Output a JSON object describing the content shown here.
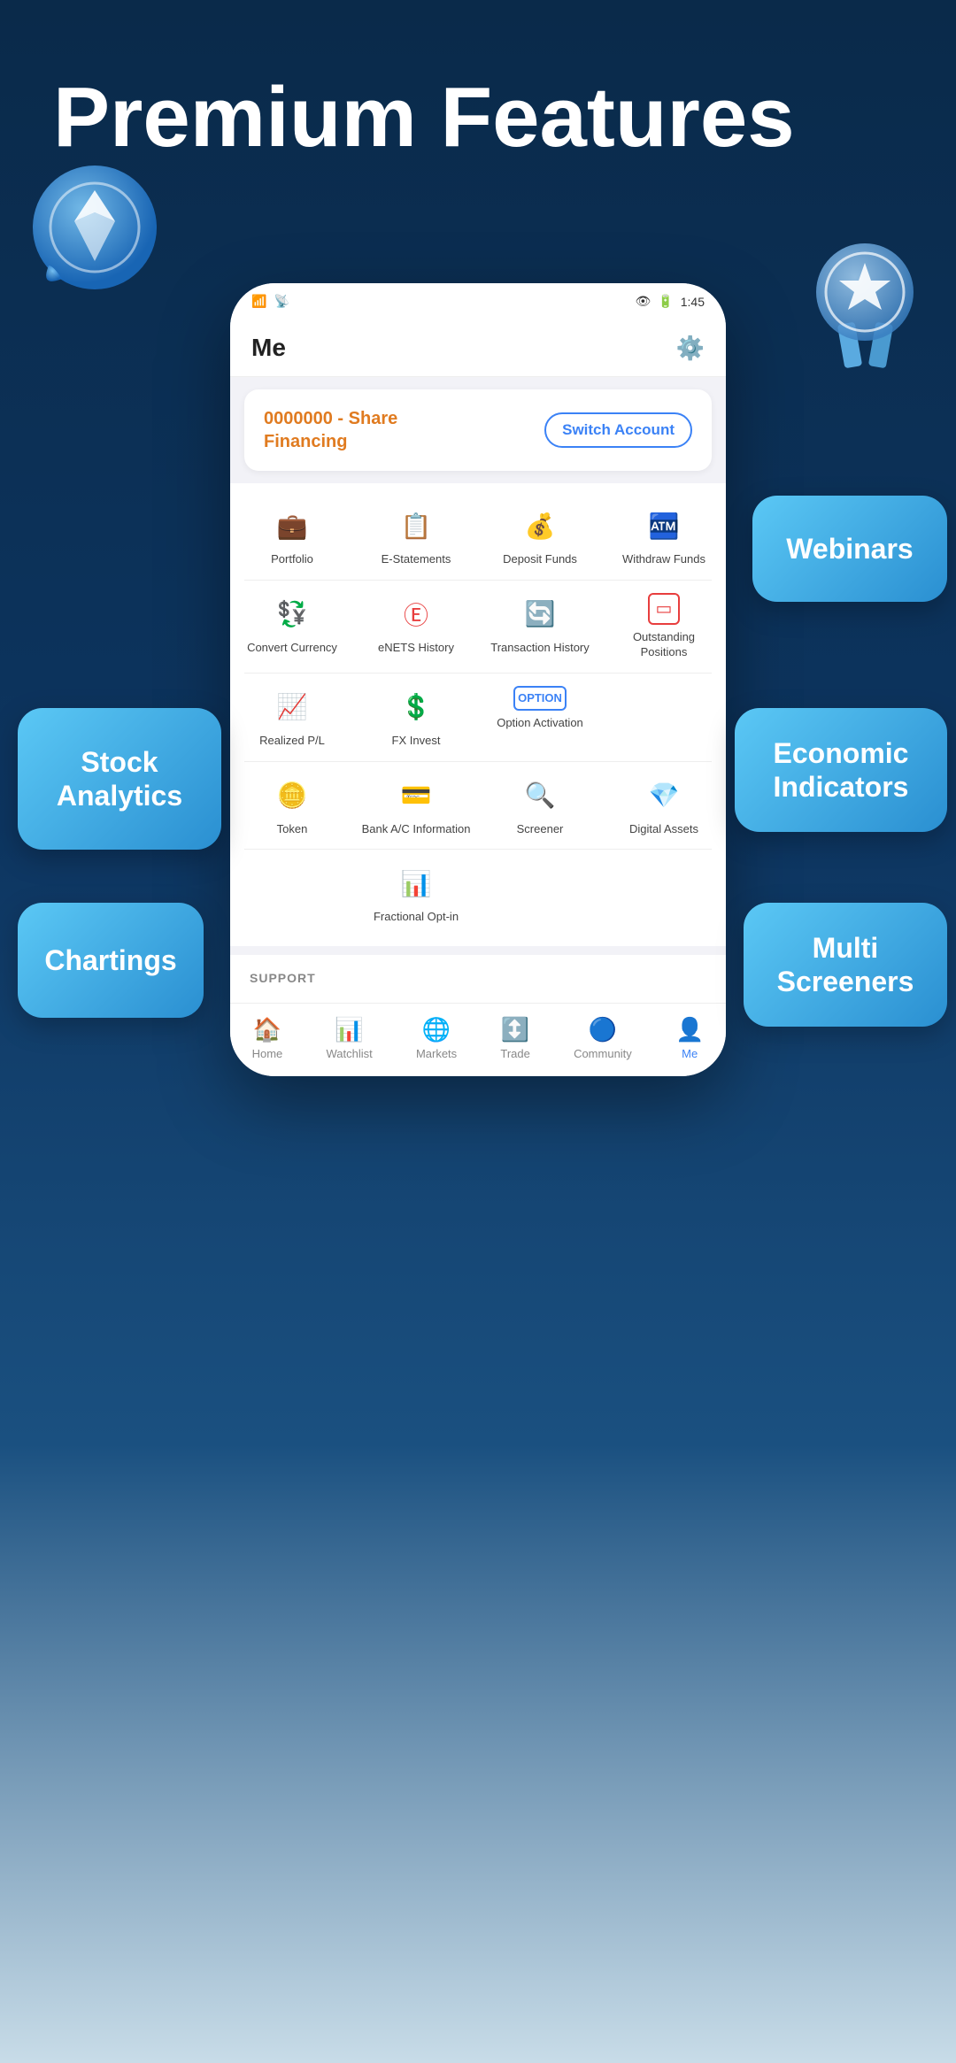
{
  "header": {
    "title": "Premium Features"
  },
  "status_bar": {
    "left": "4G signal wifi",
    "time": "1:45",
    "battery": "🔋"
  },
  "app": {
    "title": "Me",
    "settings_icon": "⚙️",
    "account_text": "0000000 - Share\nFinancing",
    "switch_button": "Switch Account"
  },
  "menu_rows": [
    [
      {
        "icon": "💼",
        "label": "Portfolio",
        "color": "#f5a623"
      },
      {
        "icon": "📋",
        "label": "E-Statements",
        "color": "#7b5ea7"
      },
      {
        "icon": "💰",
        "label": "Deposit Funds",
        "color": "#2dc58c"
      },
      {
        "icon": "🏧",
        "label": "Withdraw Funds",
        "color": "#3b82f6"
      }
    ],
    [
      {
        "icon": "💱",
        "label": "Convert Currency",
        "color": "#e07b20"
      },
      {
        "icon": "©️",
        "label": "eNETS History",
        "color": "#e83e3e"
      },
      {
        "icon": "🔄",
        "label": "Transaction History",
        "color": "#2dc58c"
      },
      {
        "icon": "⬜",
        "label": "Outstanding Positions",
        "color": "#e83e3e"
      }
    ],
    [
      {
        "icon": "📈",
        "label": "Realized P/L",
        "color": "#3b82f6"
      },
      {
        "icon": "💲",
        "label": "FX Invest",
        "color": "#e07b20"
      },
      {
        "icon": "🔲",
        "label": "Option Activation",
        "color": "#3b82f6"
      },
      {
        "icon": "",
        "label": "",
        "color": "transparent"
      }
    ],
    [
      {
        "icon": "🪙",
        "label": "Token",
        "color": "#e07b20"
      },
      {
        "icon": "💳",
        "label": "Bank A/C Information",
        "color": "#f5a623"
      },
      {
        "icon": "🔍",
        "label": "Screener",
        "color": "#7b5ea7"
      },
      {
        "icon": "💎",
        "label": "Digital Assets",
        "color": "#2dc58c"
      }
    ],
    [
      {
        "icon": "",
        "label": "",
        "color": "transparent"
      },
      {
        "icon": "📊",
        "label": "Fractional Opt-in",
        "color": "#2dc58c"
      },
      {
        "icon": "",
        "label": "",
        "color": "transparent"
      },
      {
        "icon": "",
        "label": "",
        "color": "transparent"
      }
    ]
  ],
  "support": {
    "label": "SUPPORT"
  },
  "bottom_nav": [
    {
      "icon": "🏠",
      "label": "Home",
      "active": false
    },
    {
      "icon": "📊",
      "label": "Watchlist",
      "active": false
    },
    {
      "icon": "🌐",
      "label": "Markets",
      "active": false
    },
    {
      "icon": "↕️",
      "label": "Trade",
      "active": false
    },
    {
      "icon": "🔵",
      "label": "Community",
      "active": false
    },
    {
      "icon": "👤",
      "label": "Me",
      "active": true
    }
  ],
  "badges": {
    "stock_analytics": "Stock\nAnalytics",
    "webinars": "Webinars",
    "economic_indicators": "Economic\nIndicators",
    "chartings": "Chartings",
    "multi_screeners": "Multi\nScreeners"
  }
}
